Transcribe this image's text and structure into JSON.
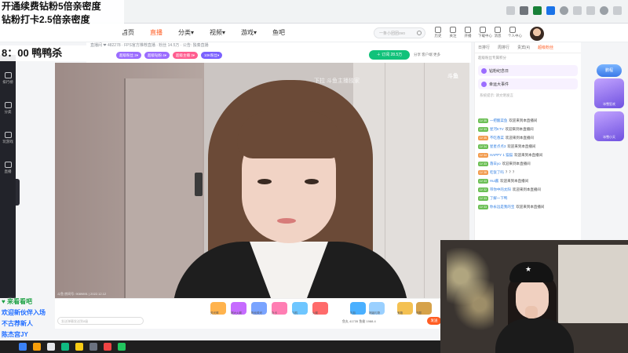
{
  "overlays": {
    "promo_line1": "开通续费钻粉5倍亲密度",
    "promo_line2": "钻粉打卡2.5倍亲密度",
    "schedule": "8：00 鸭鸭杀"
  },
  "nav": {
    "items": [
      {
        "label": "首页"
      },
      {
        "label": "直播",
        "active": true
      },
      {
        "label": "分类▾"
      },
      {
        "label": "视频▾"
      },
      {
        "label": "游戏▾"
      },
      {
        "label": "鱼吧"
      }
    ],
    "search_placeholder": "一条小团团ovo",
    "icons": [
      {
        "label": "历史"
      },
      {
        "label": "关注"
      },
      {
        "label": "开播"
      },
      {
        "label": "下载中心"
      },
      {
        "label": "消息"
      },
      {
        "label": "个人中心"
      }
    ]
  },
  "room": {
    "info_line": "直播间  ❤ 482278  ·  FPS官方推荐直播  ·  粉丝 14.5万  ·  公告: 独奏直播",
    "badges": [
      {
        "label": "超级粉丝 2▾",
        "color": "#9b6cff"
      },
      {
        "label": "超级钻粉 4▾",
        "color": "#9b6cff"
      },
      {
        "label": "超级主播 3▾",
        "color": "#ff5d8f"
      },
      {
        "label": "10K粉丝▾",
        "color": "#7b61ff"
      }
    ],
    "follow_label": "＋ 订阅 28.5万",
    "share_label": "分享  客户端  更多"
  },
  "player": {
    "watermark": "下拉  斗鱼主播独家",
    "corner_logo": "斗鱼",
    "room_tag": "斗鱼  房间号: 9089891  |  2022.12.12"
  },
  "gift_bar": {
    "gifts": [
      {
        "label": "荧光棒",
        "color": "#ffb34d"
      },
      {
        "label": "超大火箭",
        "color": "#c66bff"
      },
      {
        "label": "粉丝荧光",
        "color": "#7aa4ff"
      },
      {
        "label": "办卡",
        "color": "#ff7eb3"
      },
      {
        "label": "飞机",
        "color": "#6ec6ff"
      },
      {
        "label": "火箭",
        "color": "#ff6b6b"
      },
      {
        "label": "礼包",
        "color": "#4ab0ff"
      },
      {
        "label": "超级礼物",
        "color": "#9ad0ff"
      },
      {
        "label": "宝箱",
        "color": "#f4c152"
      },
      {
        "label": "许愿",
        "color": "#d6a24a"
      }
    ],
    "chat_placeholder": "发送弹幕发送到8级",
    "coins": "鱼丸 41735   鱼翅 1988.4",
    "send_label": "发送"
  },
  "right_panel": {
    "tabs": [
      {
        "label": "日排行"
      },
      {
        "label": "周排行"
      },
      {
        "label": "贵宾(4)"
      },
      {
        "label": "超级粉丝"
      }
    ],
    "subtitle": "超级粉丝专属积分",
    "cards": [
      {
        "label": "钻粉纪念日"
      },
      {
        "label": "幸运大事件"
      }
    ],
    "notice": "系统提示: 请文明发言",
    "chat": [
      {
        "level": "LV 35",
        "name": "一把酸菜鱼",
        "text": "欢迎来到本直播间"
      },
      {
        "level": "LV 33",
        "name": "星河KTV",
        "text": "欢迎来到本直播间"
      },
      {
        "level": "LV 35",
        "name": "不吃香菜",
        "text": "欢迎来到本直播间"
      },
      {
        "level": "LV 34",
        "name": "星星点点3",
        "text": "欢迎来到本直播间"
      },
      {
        "level": "LV 34",
        "name": "HAPPY 1 猫猫",
        "text": "欢迎来到本直播间"
      },
      {
        "level": "LV 33",
        "name": "落日yo",
        "text": "欢迎来到本直播间"
      },
      {
        "level": "LV 38",
        "name": "吃饭了吗",
        "text": "？？？"
      },
      {
        "level": "LV 33",
        "name": "Hui酱",
        "text": "欢迎来到本直播间"
      },
      {
        "level": "LV 32",
        "name": "带你中的太阳",
        "text": "欢迎来到本直播间"
      },
      {
        "level": "LV 33",
        "name": "了解一下鸭",
        "text": ""
      },
      {
        "level": "LV 33",
        "name": "你永远是我的宝",
        "text": "欢迎来到本直播间"
      }
    ]
  },
  "activities": {
    "tag": "鹏程",
    "boxes": [
      {
        "label": "冰雪狂欢"
      },
      {
        "label": "冰雪小天"
      }
    ]
  },
  "ticker": [
    {
      "text": "♥ 来看看吧",
      "style": "green"
    },
    {
      "text": "欢迎新伙伴入场",
      "style": "blue"
    },
    {
      "text": "不古荐新人",
      "style": "blue"
    },
    {
      "text": "陈杰宫JY",
      "style": "blue"
    },
    {
      "text": "逐渐入场",
      "style": "green"
    }
  ],
  "rail": {
    "items": [
      {
        "label": "排行榜"
      },
      {
        "label": "分类"
      },
      {
        "label": "玩游戏"
      },
      {
        "label": "直播"
      }
    ]
  }
}
